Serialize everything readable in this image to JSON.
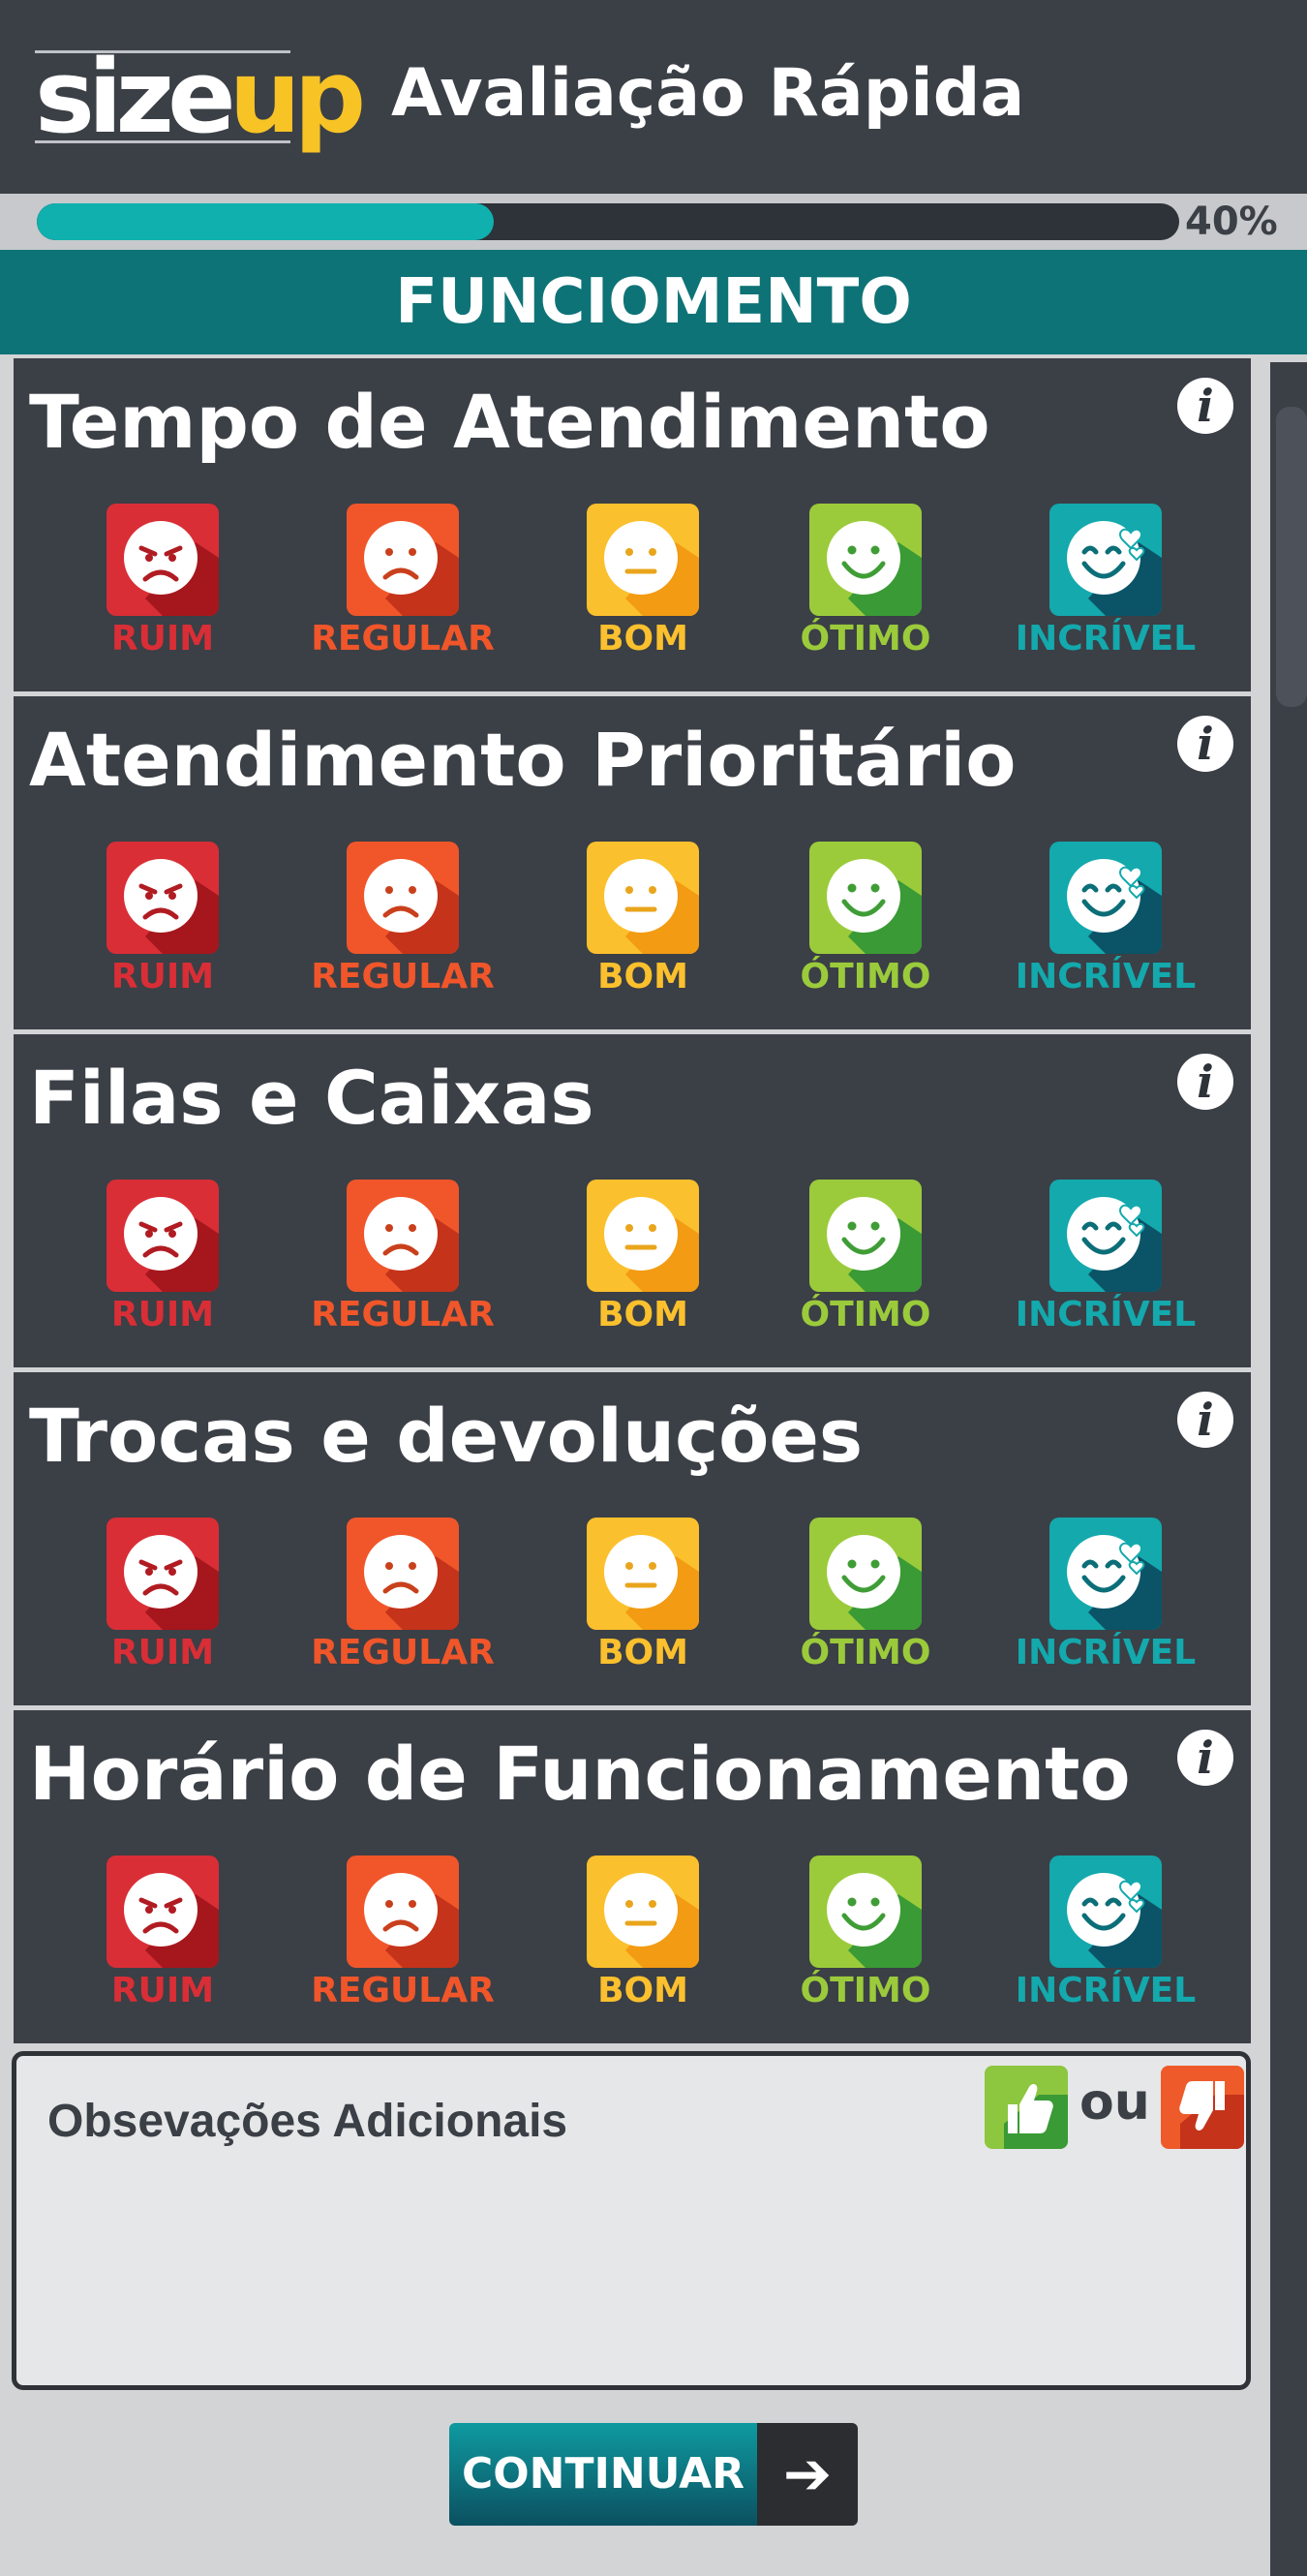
{
  "header": {
    "logo_part1": "size",
    "logo_part2": "up",
    "title": "Avaliação Rápida"
  },
  "progress": {
    "value": 0.4,
    "label": "40%"
  },
  "section": {
    "title": "FUNCIOMENTO"
  },
  "colors": {
    "header_bg": "#3b3f46",
    "accent_teal": "#0e7377",
    "progress_fill": "#0fb0ae",
    "ruim": "#c9272f",
    "regular": "#ee5a2a",
    "bom": "#fbc02d",
    "otimo": "#8dc63f",
    "incrivel": "#0aa3a8"
  },
  "rating_options": [
    {
      "label": "RUIM",
      "icon": "angry-face-icon",
      "color": "#d92e36"
    },
    {
      "label": "REGULAR",
      "icon": "sad-face-icon",
      "color": "#f0562a"
    },
    {
      "label": "BOM",
      "icon": "neutral-face-icon",
      "color": "#fbc02d"
    },
    {
      "label": "ÓTIMO",
      "icon": "happy-face-icon",
      "color": "#9bcb3b"
    },
    {
      "label": "INCRÍVEL",
      "icon": "love-face-icon",
      "color": "#13a9ad"
    }
  ],
  "questions": [
    {
      "title": "Tempo de Atendimento"
    },
    {
      "title": "Atendimento Prioritário"
    },
    {
      "title": "Filas e Caixas"
    },
    {
      "title": "Trocas e devoluções"
    },
    {
      "title": "Horário de Funcionamento"
    }
  ],
  "info_glyph": "i",
  "observations": {
    "label": "Obsevações Adicionais",
    "or_text": "ou",
    "like_icon": "thumbs-up-icon",
    "dislike_icon": "thumbs-down-icon"
  },
  "continue_button": {
    "label": "CONTINUAR",
    "arrow": "➔"
  }
}
